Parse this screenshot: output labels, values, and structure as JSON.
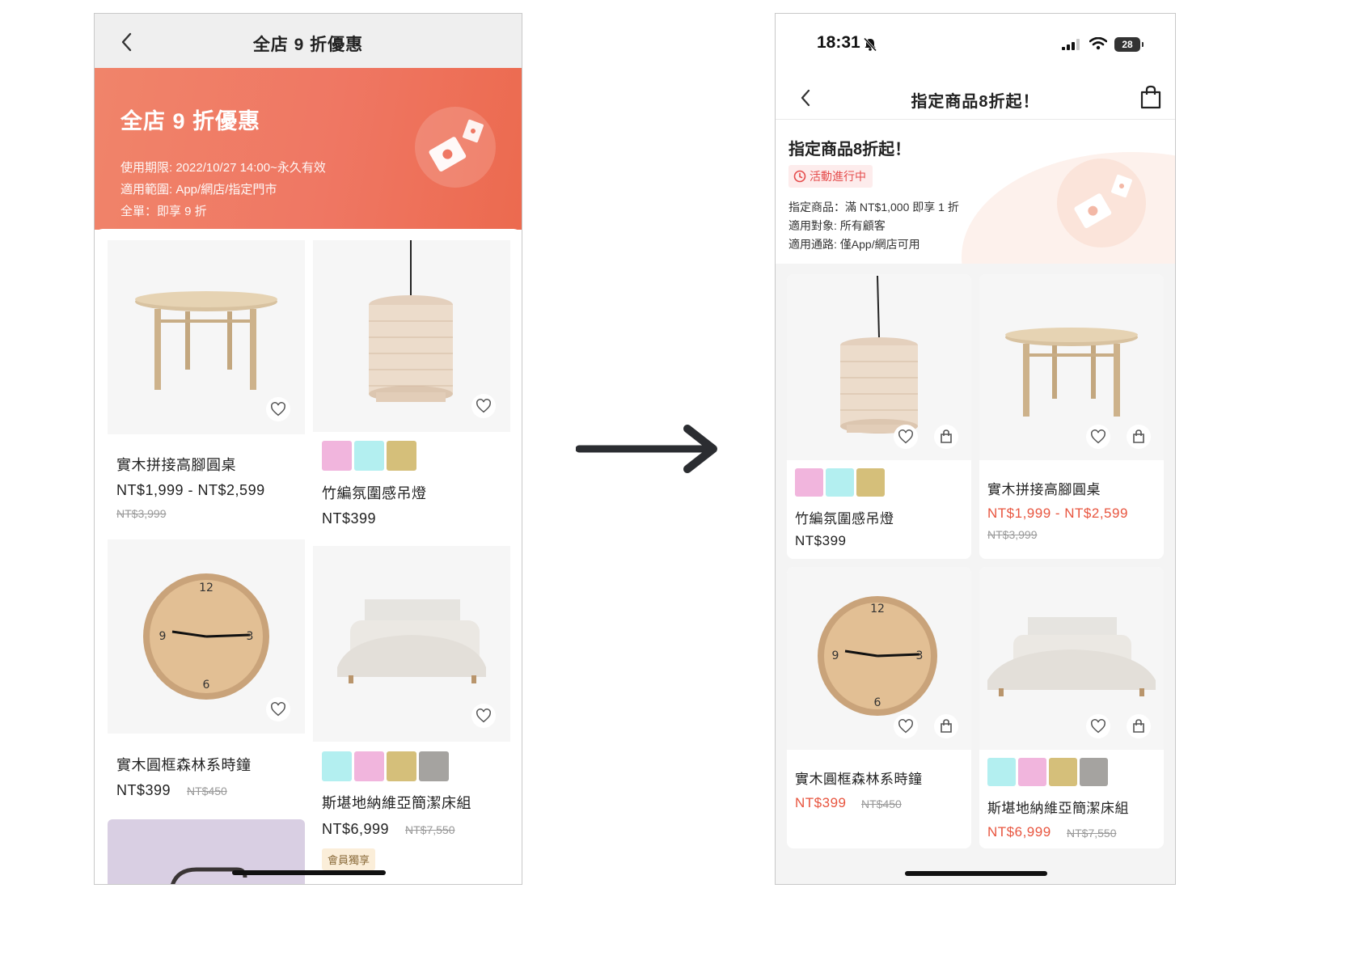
{
  "left_screen": {
    "nav_title": "全店 9 折優惠",
    "banner": {
      "title": "全店 9 折優惠",
      "line1": "使用期限: 2022/10/27 14:00~永久有效",
      "line2": "適用範圍: App/網店/指定門市",
      "line3": "全單：即享 9 折"
    },
    "products": [
      {
        "name": "實木拼接高腳圓桌",
        "price": "NT$1,999 - NT$2,599",
        "original_price": "NT$3,999"
      },
      {
        "name": "竹編氛圍感吊燈",
        "price": "NT$399",
        "swatches": [
          "#f1b5dd",
          "#b3eff0",
          "#d5bf7a"
        ]
      },
      {
        "name": "實木圓框森林系時鐘",
        "price": "NT$399",
        "original_price": "NT$450"
      },
      {
        "name": "斯堪地納維亞簡潔床組",
        "price": "NT$6,999",
        "original_price": "NT$7,550",
        "badge": "會員獨享",
        "swatches": [
          "#b3eff0",
          "#f1b5dd",
          "#d5bf7a",
          "#a5a3a0"
        ]
      }
    ]
  },
  "right_screen": {
    "status_bar": {
      "time": "18:31",
      "battery": "28"
    },
    "nav_title": "指定商品8折起！",
    "header": {
      "title": "指定商品8折起！",
      "status": "活動進行中",
      "line1": "指定商品：滿 NT$1,000 即享 1 折",
      "line2": "適用對象: 所有顧客",
      "line3": "適用通路: 僅App/網店可用"
    },
    "products": [
      {
        "name": "竹編氛圍感吊燈",
        "price": "NT$399",
        "swatches": [
          "#f1b5dd",
          "#b3eff0",
          "#d5bf7a"
        ]
      },
      {
        "name": "實木拼接高腳圓桌",
        "price": "NT$1,999 - NT$2,599",
        "original_price": "NT$3,999"
      },
      {
        "name": "實木圓框森林系時鐘",
        "price": "NT$399",
        "original_price": "NT$450"
      },
      {
        "name": "斯堪地納維亞簡潔床組",
        "price": "NT$6,999",
        "original_price": "NT$7,550",
        "swatches": [
          "#b3eff0",
          "#f1b5dd",
          "#d5bf7a",
          "#a5a3a0"
        ]
      }
    ]
  },
  "colors": {
    "banner": "#ef7763",
    "sale_price": "#e8553f",
    "status": "#e54b4b",
    "arrow": "#2b2d31"
  },
  "icons": [
    "back-chevron-icon",
    "heart-icon",
    "shopping-bag-icon",
    "coupon-icon",
    "clock-icon",
    "silent-bell-icon",
    "signal-icon",
    "wifi-icon",
    "battery-icon",
    "arrow-right-icon"
  ]
}
